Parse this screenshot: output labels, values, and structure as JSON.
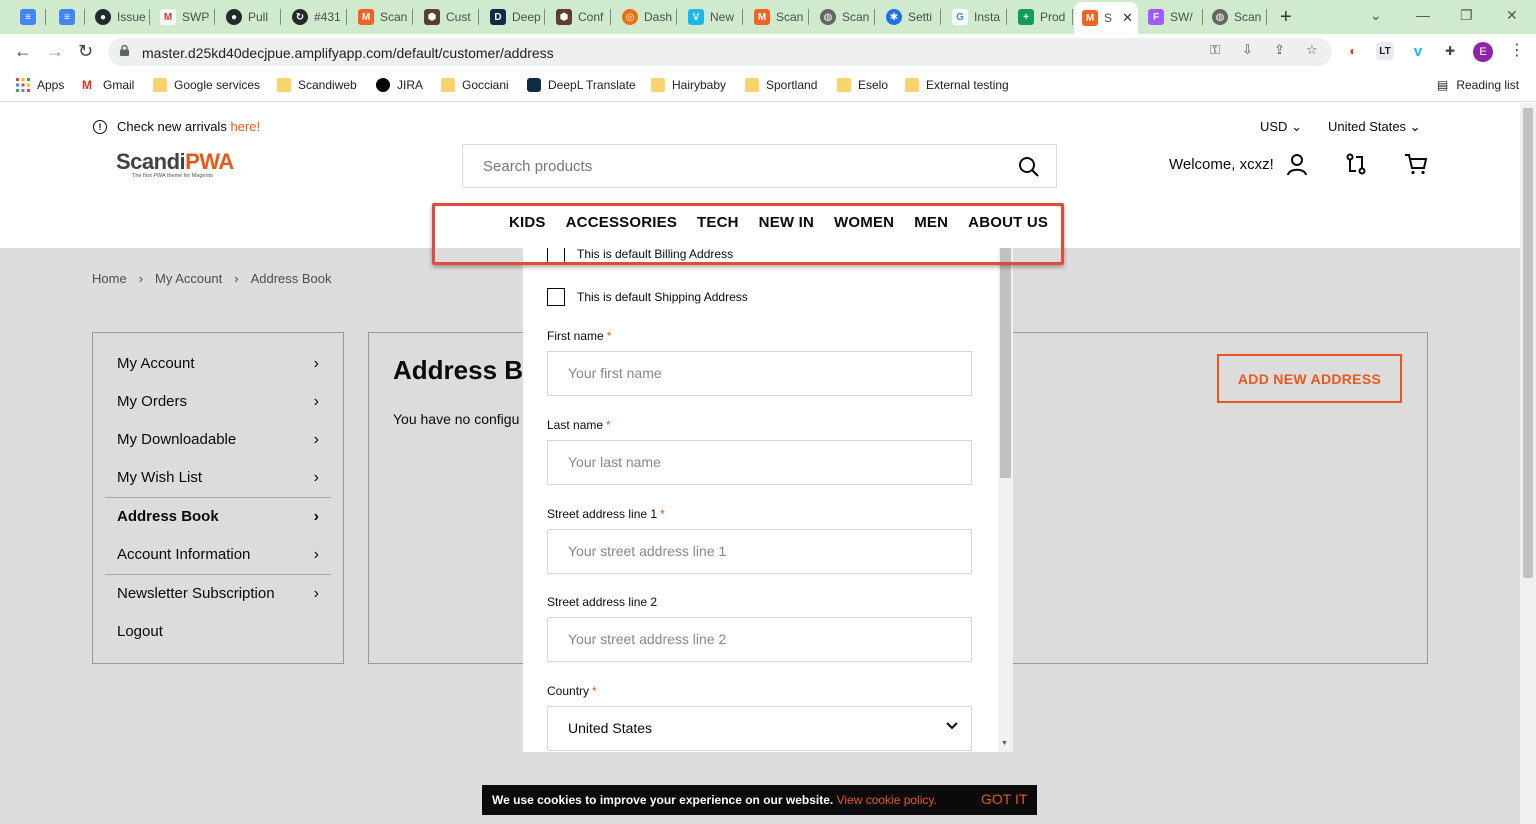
{
  "browser": {
    "tabs": [
      {
        "label": "",
        "fav": "docs"
      },
      {
        "label": "",
        "fav": "docs"
      },
      {
        "label": "Issue",
        "fav": "github"
      },
      {
        "label": "SWP",
        "fav": "gmail"
      },
      {
        "label": "Pull",
        "fav": "github"
      },
      {
        "label": "#431",
        "fav": "github-pr"
      },
      {
        "label": "Scan",
        "fav": "magento"
      },
      {
        "label": "Cust",
        "fav": "hex"
      },
      {
        "label": "Deep",
        "fav": "deepl"
      },
      {
        "label": "Conf",
        "fav": "hex"
      },
      {
        "label": "Dash",
        "fav": "chrome"
      },
      {
        "label": "New",
        "fav": "vimeo"
      },
      {
        "label": "Scan",
        "fav": "magento"
      },
      {
        "label": "Scan",
        "fav": "globe"
      },
      {
        "label": "Setti",
        "fav": "gear"
      },
      {
        "label": "Insta",
        "fav": "google"
      },
      {
        "label": "Prod",
        "fav": "sheets"
      },
      {
        "label": "S",
        "fav": "magento",
        "active": true
      },
      {
        "label": "SW/",
        "fav": "figma"
      },
      {
        "label": "Scan",
        "fav": "globe"
      }
    ],
    "new_tab": "+",
    "url": "master.d25kd40decjpue.amplifyapp.com/default/customer/address",
    "bookmarks": [
      {
        "label": "Apps",
        "icon": "apps-grid"
      },
      {
        "label": "Gmail",
        "icon": "gmail"
      },
      {
        "label": "Google services",
        "icon": "folder"
      },
      {
        "label": "Scandiweb",
        "icon": "folder"
      },
      {
        "label": "JIRA",
        "icon": "jira"
      },
      {
        "label": "Gocciani",
        "icon": "folder"
      },
      {
        "label": "DeepL Translate",
        "icon": "deepl"
      },
      {
        "label": "Hairybaby",
        "icon": "folder"
      },
      {
        "label": "Sportland",
        "icon": "folder"
      },
      {
        "label": "Eselo",
        "icon": "folder"
      },
      {
        "label": "External testing",
        "icon": "folder"
      }
    ],
    "reading_list": "Reading list",
    "profile_initial": "E"
  },
  "header": {
    "notice_text": "Check new arrivals",
    "notice_link": "here!",
    "currency": "USD",
    "country": "United States",
    "logo_text_a": "Scandi",
    "logo_text_b": "PWA",
    "logo_tagline": "The first PWA theme for Magento",
    "search_placeholder": "Search products",
    "welcome": "Welcome, xcxz!",
    "menu": [
      "KIDS",
      "ACCESSORIES",
      "TECH",
      "NEW IN",
      "WOMEN",
      "MEN",
      "ABOUT US"
    ]
  },
  "breadcrumbs": [
    "Home",
    "My Account",
    "Address Book"
  ],
  "sidebar": {
    "items": [
      {
        "label": "My Account",
        "bold": false
      },
      {
        "label": "My Orders",
        "bold": false
      },
      {
        "label": "My Downloadable",
        "bold": false
      },
      {
        "label": "My Wish List",
        "bold": false
      },
      {
        "label": "Address Book",
        "bold": true
      },
      {
        "label": "Account Information",
        "bold": false
      },
      {
        "label": "Newsletter Subscription",
        "bold": false
      },
      {
        "label": "Logout",
        "bold": false
      }
    ]
  },
  "main": {
    "title": "Address Bo",
    "empty_text": "You have no configu",
    "add_button": "ADD NEW ADDRESS"
  },
  "form": {
    "billing_checkbox": "This is default Billing Address",
    "shipping_checkbox": "This is default Shipping Address",
    "fields": [
      {
        "label": "First name",
        "required": true,
        "placeholder": "Your first name"
      },
      {
        "label": "Last name",
        "required": true,
        "placeholder": "Your last name"
      },
      {
        "label": "Street address line 1",
        "required": true,
        "placeholder": "Your street address line 1"
      },
      {
        "label": "Street address line 2",
        "required": false,
        "placeholder": "Your street address line 2"
      }
    ],
    "country_label": "Country",
    "country_value": "United States"
  },
  "cookie": {
    "message": "We use cookies to improve your experience on our website.",
    "link": "View cookie policy.",
    "button": "GOT IT"
  },
  "colors": {
    "accent": "#e55a1c",
    "highlight_border": "#e04b3c",
    "tabstrip": "#cfeacd",
    "page_overlay": "#dddddd"
  }
}
